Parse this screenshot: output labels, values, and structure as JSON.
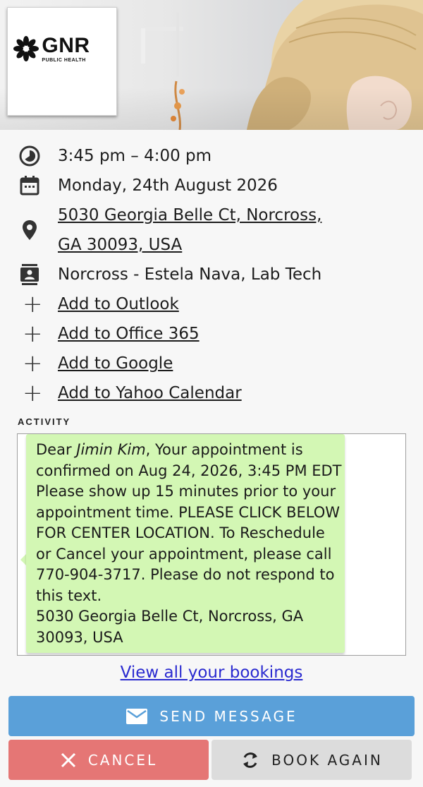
{
  "header": {
    "logo": {
      "brand": "GNR",
      "subtitle": "PUBLIC HEALTH"
    }
  },
  "details": {
    "time": "3:45 pm – 4:00 pm",
    "date": "Monday, 24th August 2026",
    "address_line1": "5030 Georgia Belle Ct, Norcross,",
    "address_line2": "GA 30093, USA",
    "provider": "Norcross - Estela Nava, Lab Tech"
  },
  "calendar_links": [
    {
      "label": "Add to Outlook"
    },
    {
      "label": "Add to Office 365"
    },
    {
      "label": "Add to Google"
    },
    {
      "label": "Add to Yahoo Calendar"
    }
  ],
  "activity": {
    "label": "ACTIVITY",
    "message": {
      "greeting": "Dear ",
      "name": "Jimin Kim",
      "body": ", Your appointment is confirmed on Aug 24, 2026, 3:45 PM EDT Please show up 15 minutes prior to your appointment time. PLEASE CLICK BELOW FOR CENTER LOCATION. To Reschedule or Cancel your appointment, please call 770-904-3717. Please do not respond to this text.",
      "address": "5030 Georgia Belle Ct, Norcross, GA 30093, USA"
    }
  },
  "links": {
    "view_all": "View all your bookings"
  },
  "buttons": {
    "send": "SEND MESSAGE",
    "cancel": "CANCEL",
    "book_again": "BOOK AGAIN"
  },
  "colors": {
    "send_bg": "#5aa0d9",
    "cancel_bg": "#e57675",
    "book_bg": "#dcdcdc",
    "bubble_bg": "#d3f7b4",
    "link_blue": "#2a2ad0"
  },
  "icons": [
    "clock-icon",
    "calendar-icon",
    "location-pin-icon",
    "contact-card-icon",
    "plus-icon",
    "envelope-icon",
    "close-icon",
    "refresh-icon"
  ]
}
